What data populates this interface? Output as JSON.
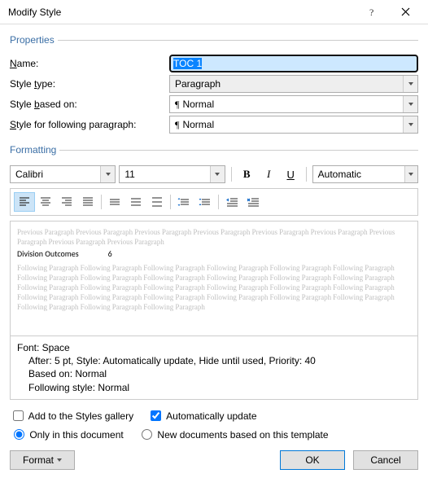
{
  "window": {
    "title": "Modify Style"
  },
  "properties": {
    "legend": "Properties",
    "name_label_pre": "",
    "name_label": "Name:",
    "name_value": "TOC 1",
    "styletype_label": "Style type:",
    "styletype_value": "Paragraph",
    "basedon_label": "Style based on:",
    "basedon_value": "Normal",
    "following_label": "Style for following paragraph:",
    "following_value": "Normal"
  },
  "formatting": {
    "legend": "Formatting",
    "font": "Calibri",
    "size": "11",
    "color_label": "Automatic"
  },
  "preview": {
    "prev": "Previous Paragraph Previous Paragraph Previous Paragraph Previous Paragraph Previous Paragraph Previous Paragraph Previous Paragraph Previous Paragraph Previous Paragraph",
    "sample_text": "Division Outcomes",
    "sample_num": "6",
    "foll": "Following Paragraph Following Paragraph Following Paragraph Following Paragraph Following Paragraph Following Paragraph Following Paragraph Following Paragraph Following Paragraph Following Paragraph Following Paragraph Following Paragraph Following Paragraph Following Paragraph Following Paragraph Following Paragraph Following Paragraph Following Paragraph Following Paragraph Following Paragraph Following Paragraph Following Paragraph Following Paragraph Following Paragraph Following Paragraph Following Paragraph Following Paragraph"
  },
  "desc": {
    "line1": "Font: Space",
    "line2": "After:  5 pt, Style: Automatically update, Hide until used, Priority: 40",
    "line3": "Based on: Normal",
    "line4": "Following style: Normal"
  },
  "options": {
    "add_gallery": "Add to the Styles gallery",
    "auto_update": "Automatically update",
    "only_doc": "Only in this document",
    "new_docs": "New documents based on this template"
  },
  "footer": {
    "format": "Format",
    "ok": "OK",
    "cancel": "Cancel"
  }
}
